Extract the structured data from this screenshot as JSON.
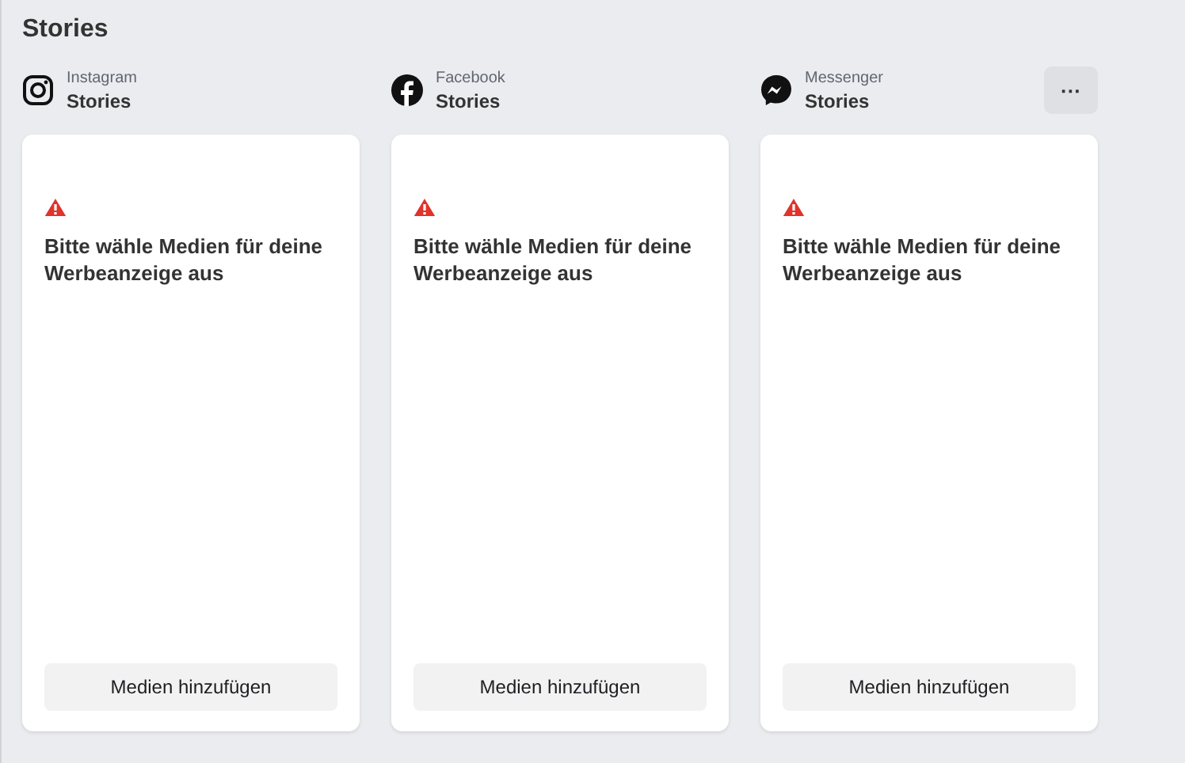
{
  "title": "Stories",
  "placements": [
    {
      "kind": "instagram",
      "platform": "Instagram",
      "placement": "Stories",
      "message": "Bitte wähle Medien für deine Werbeanzeige aus",
      "button": "Medien hinzufügen"
    },
    {
      "kind": "facebook",
      "platform": "Facebook",
      "placement": "Stories",
      "message": "Bitte wähle Medien für deine Werbeanzeige aus",
      "button": "Medien hinzufügen"
    },
    {
      "kind": "messenger",
      "platform": "Messenger",
      "placement": "Stories",
      "message": "Bitte wähle Medien für deine Werbeanzeige aus",
      "button": "Medien hinzufügen",
      "more_button": "···"
    }
  ]
}
